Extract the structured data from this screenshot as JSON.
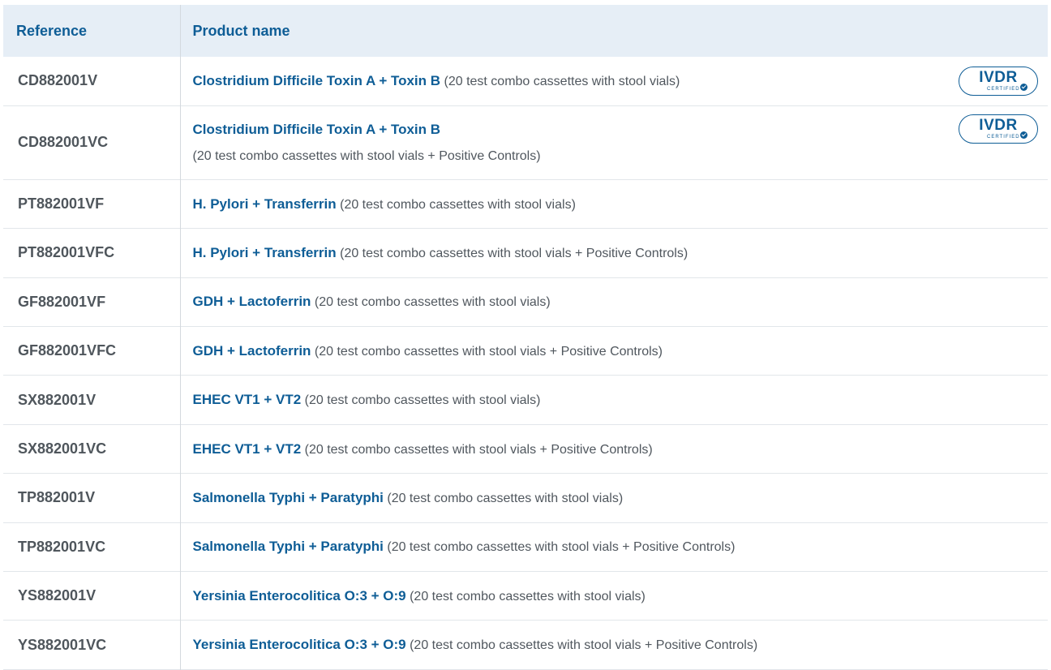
{
  "table": {
    "headers": {
      "reference": "Reference",
      "product_name": "Product name"
    },
    "badge": {
      "main": "IVDR",
      "sub": "CERTIFIED"
    },
    "rows": [
      {
        "reference": "CD882001V",
        "name": "Clostridium Difficile Toxin A + Toxin B",
        "desc": "(20 test combo cassettes with stool vials)",
        "ivdr": true
      },
      {
        "reference": "CD882001VC",
        "name": "Clostridium Difficile Toxin A + Toxin B",
        "desc": "(20 test combo cassettes with stool vials + Positive Controls)",
        "ivdr": true
      },
      {
        "reference": "PT882001VF",
        "name": "H. Pylori + Transferrin",
        "desc": "(20 test combo cassettes with stool vials)"
      },
      {
        "reference": "PT882001VFC",
        "name": "H. Pylori + Transferrin",
        "desc": "(20 test combo cassettes with stool vials + Positive Controls)"
      },
      {
        "reference": "GF882001VF",
        "name": "GDH + Lactoferrin",
        "desc": "(20 test combo cassettes with stool vials)"
      },
      {
        "reference": "GF882001VFC",
        "name": "GDH + Lactoferrin",
        "desc": "(20 test combo cassettes with stool vials + Positive Controls)"
      },
      {
        "reference": "SX882001V",
        "name": "EHEC VT1 + VT2",
        "desc": "(20 test combo cassettes with stool vials)"
      },
      {
        "reference": "SX882001VC",
        "name": "EHEC VT1 + VT2",
        "desc": "(20 test combo cassettes with stool vials + Positive Controls)"
      },
      {
        "reference": "TP882001V",
        "name": "Salmonella Typhi + Paratyphi",
        "desc": "(20 test combo cassettes with stool vials)"
      },
      {
        "reference": "TP882001VC",
        "name": "Salmonella Typhi + Paratyphi",
        "desc": "(20 test combo cassettes with stool vials + Positive Controls)"
      },
      {
        "reference": "YS882001V",
        "name": "Yersinia Enterocolitica O:3 + O:9",
        "desc": "(20 test combo cassettes with stool vials)"
      },
      {
        "reference": "YS882001VC",
        "name": "Yersinia Enterocolitica O:3 + O:9",
        "desc": "(20 test combo cassettes with stool vials + Positive Controls)"
      }
    ]
  }
}
